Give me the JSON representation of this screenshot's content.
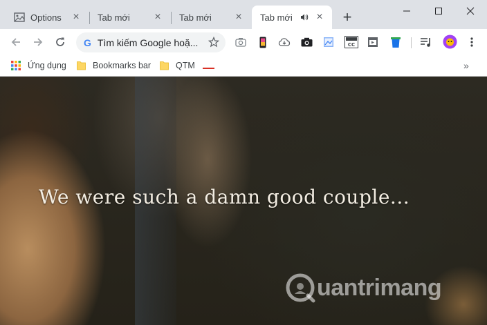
{
  "tabs": [
    {
      "title": "Options",
      "active": false,
      "favicon": "image-icon"
    },
    {
      "title": "Tab mới",
      "active": false
    },
    {
      "title": "Tab mới",
      "active": false
    },
    {
      "title": "Tab mới",
      "active": true,
      "audio": "speaker-icon"
    }
  ],
  "toolbar": {
    "omnibox_placeholder": "Tìm kiếm Google hoặ...",
    "extensions": [
      "camera-icon",
      "phone-icon",
      "cloud-download-icon",
      "camera-solid-icon",
      "image-icon",
      "subtitle-cc-icon",
      "video-icon",
      "trash-icon",
      "playlist-icon",
      "avatar",
      "menu-icon"
    ]
  },
  "bookmarks": [
    {
      "label": "Ứng dụng",
      "icon": "apps-grid-icon"
    },
    {
      "label": "Bookmarks bar",
      "icon": "folder-icon"
    },
    {
      "label": "QTM",
      "icon": "folder-icon"
    }
  ],
  "content": {
    "subtitle": "We were such a damn good couple...",
    "watermark": "uantrimang"
  },
  "colors": {
    "tabstrip": "#dee1e6",
    "toolbar": "#ffffff",
    "folder": "#fdd663",
    "subtitle": "#f3ede2"
  }
}
